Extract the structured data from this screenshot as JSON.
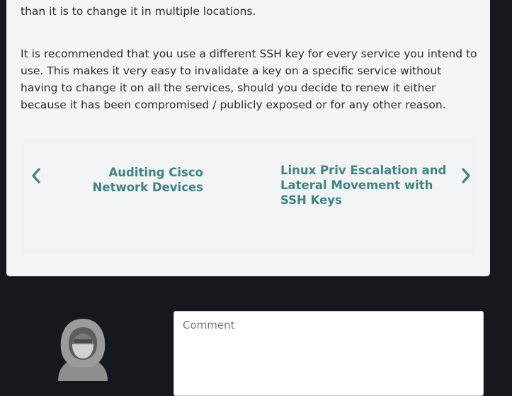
{
  "article": {
    "paragraph_1": "If a keypair becomes compromised, it is much easier to regenerate one keypair than it is to change it in multiple locations.",
    "paragraph_2": "It is recommended that you use a different SSH key for every service you intend to use. This makes it very easy to invalidate a key on a specific service without having to change it on all the services, should you decide to renew it either because it has been compromised / publicly exposed or for any other reason."
  },
  "post_navigation": {
    "previous": {
      "title": "Auditing Cisco Network Devices",
      "icon": "chevron-left-icon"
    },
    "next": {
      "title": "Linux Priv Escalation and Lateral Movement with SSH Keys",
      "icon": "chevron-right-icon"
    }
  },
  "comments": {
    "avatar_icon": "hooded-user-avatar",
    "comment_placeholder": "Comment"
  },
  "colors": {
    "page_background": "#16181d",
    "card_background": "#f3f5f7",
    "link_accent": "#3f8383",
    "avatar_gray": "#8e8e8e"
  }
}
